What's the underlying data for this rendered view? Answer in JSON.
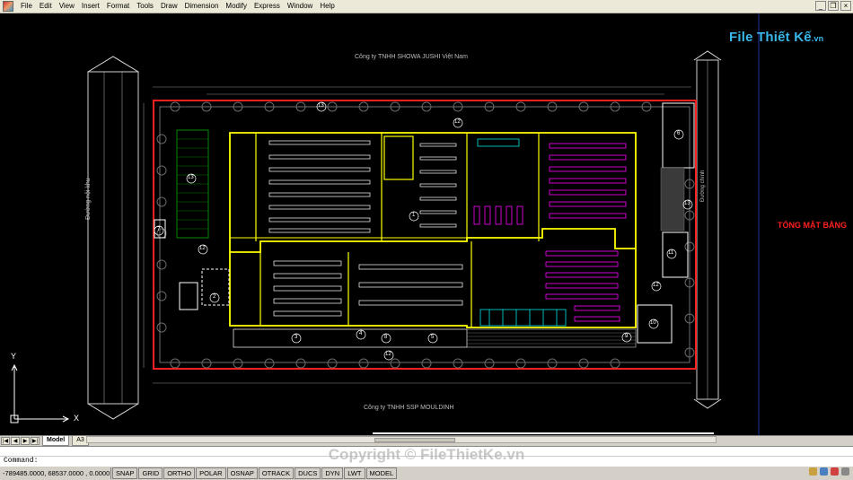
{
  "menubar": {
    "items": [
      "File",
      "Edit",
      "View",
      "Insert",
      "Format",
      "Tools",
      "Draw",
      "Dimension",
      "Modify",
      "Express",
      "Window",
      "Help"
    ]
  },
  "watermark": {
    "logo_main": "File Thiết Kế",
    "logo_suffix": ".vn",
    "copyright": "Copyright © FileThietKe.vn"
  },
  "drawing": {
    "top_company": "Công ty TNHH SHOWA JUSHI Việt Nam",
    "bottom_company": "Công ty TNHH SSP MOULDINH",
    "left_road": "Đường nội khu",
    "right_road": "Đường chính",
    "title": "TỔNG MẶT BẰNG",
    "labels": [
      "13",
      "12",
      "1",
      "13",
      "6",
      "13",
      "11",
      "12",
      "10",
      "12",
      "2",
      "7",
      "12",
      "3",
      "4",
      "5",
      "9",
      "8"
    ]
  },
  "ucs": {
    "x": "X",
    "y": "Y"
  },
  "tabs": {
    "nav": [
      "|◀",
      "◀",
      "▶",
      "▶|"
    ],
    "items": [
      "Model",
      "A3"
    ],
    "active": "Model"
  },
  "command": {
    "prompt": "Command:"
  },
  "status": {
    "coords": "-789485.0000, 68537.0000 , 0.0000",
    "buttons": [
      "SNAP",
      "GRID",
      "ORTHO",
      "POLAR",
      "OSNAP",
      "OTRACK",
      "DUCS",
      "DYN",
      "LWT",
      "MODEL"
    ]
  },
  "colors": {
    "yellow": "#ffff00",
    "magenta": "#ff00ff",
    "red": "#ff2020",
    "cyan": "#00ffff",
    "green": "#00c000",
    "white": "#ffffff",
    "grey": "#8c8c8c"
  }
}
